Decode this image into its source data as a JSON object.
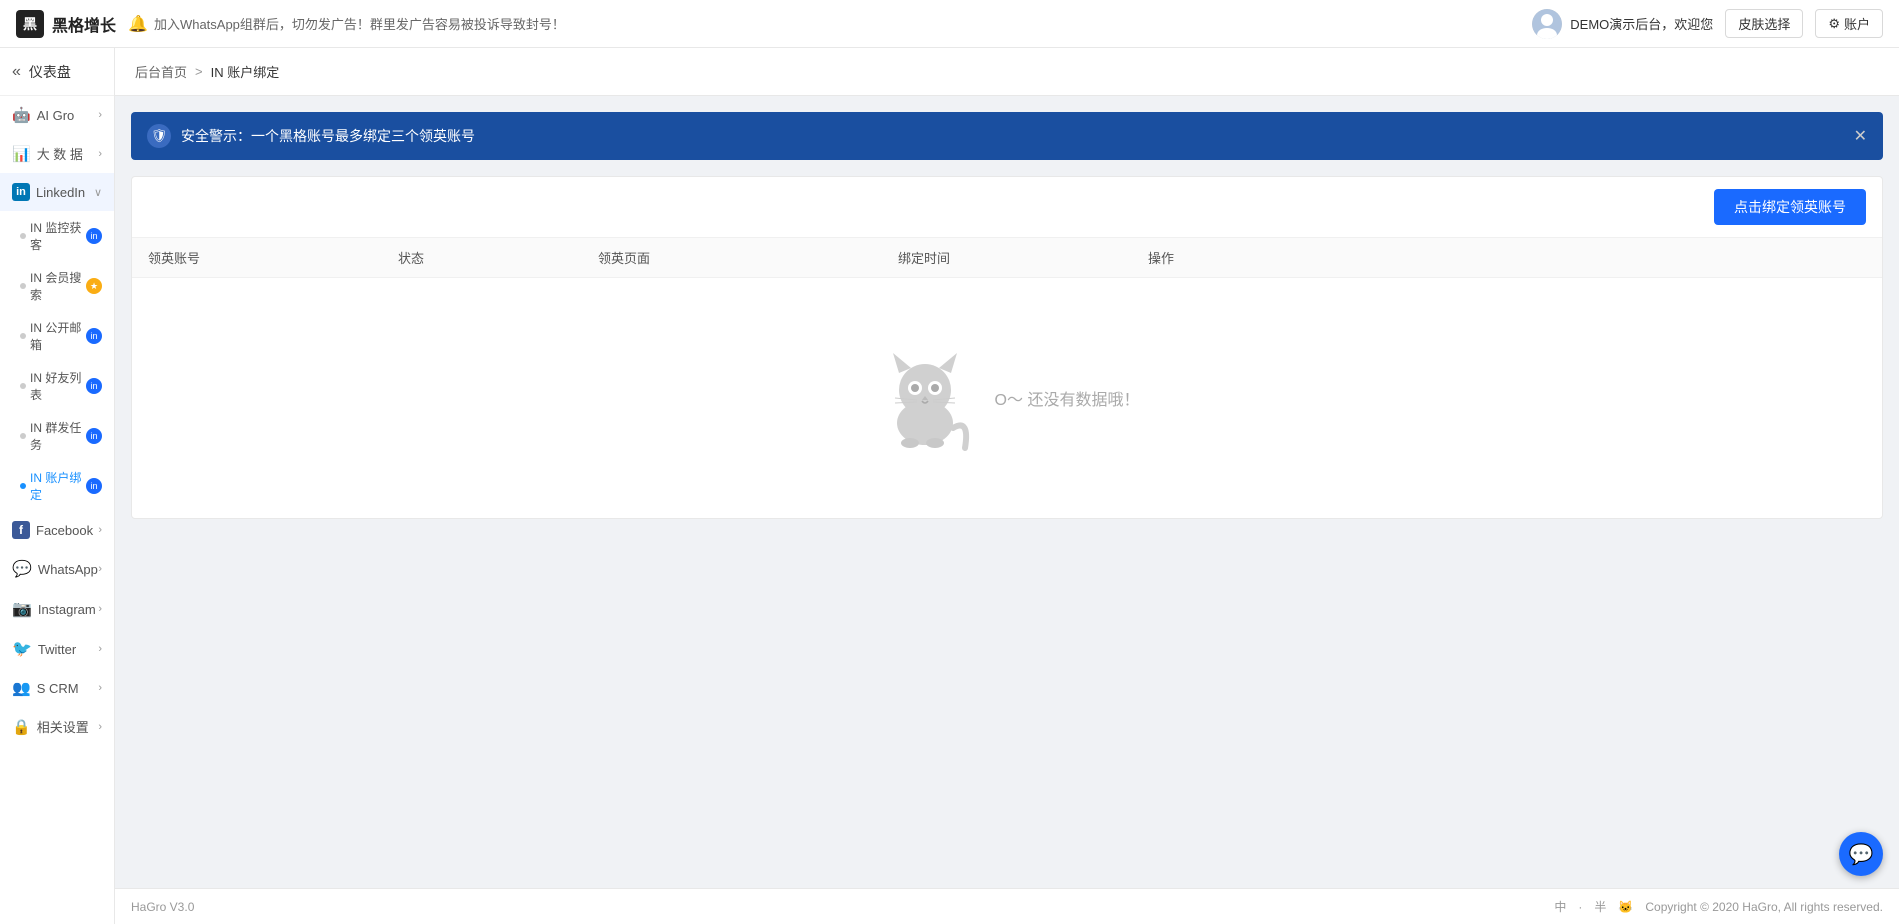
{
  "header": {
    "logo_text": "黑格增长",
    "notice_text": "加入WhatsApp组群后，切勿发广告！群里发广告容易被投诉导致封号！",
    "user_text": "DEMO演示后台，欢迎您",
    "btn_skin": "皮肤选择",
    "btn_account": "账户",
    "account_icon": "⚙"
  },
  "sidebar": {
    "dashboard_label": "仪表盘",
    "items": [
      {
        "id": "ai-gro",
        "label": "AI Gro",
        "icon": "🤖",
        "has_arrow": true
      },
      {
        "id": "big-data",
        "label": "大 数 据",
        "icon": "📊",
        "has_arrow": true
      },
      {
        "id": "linkedin",
        "label": "LinkedIn",
        "icon": "in",
        "has_arrow": true
      },
      {
        "id": "facebook",
        "label": "Facebook",
        "icon": "f",
        "has_arrow": true
      },
      {
        "id": "whatsapp",
        "label": "WhatsApp",
        "icon": "w",
        "has_arrow": true
      },
      {
        "id": "instagram",
        "label": "Instagram",
        "icon": "ig",
        "has_arrow": true
      },
      {
        "id": "twitter",
        "label": "Twitter",
        "icon": "t",
        "has_arrow": true
      },
      {
        "id": "scrm",
        "label": "S CRM",
        "icon": "👥",
        "has_arrow": true
      },
      {
        "id": "settings",
        "label": "相关设置",
        "icon": "🔒",
        "has_arrow": true
      }
    ],
    "linkedin_sub": [
      {
        "id": "in-monitor",
        "label": "IN 监控获客",
        "badge_color": "blue",
        "active": false
      },
      {
        "id": "in-member",
        "label": "IN 会员搜索",
        "badge_color": "yellow",
        "active": false
      },
      {
        "id": "in-email",
        "label": "IN 公开邮箱",
        "badge_color": "blue",
        "active": false
      },
      {
        "id": "in-friends",
        "label": "IN 好友列表",
        "badge_color": "blue",
        "active": false
      },
      {
        "id": "in-group-task",
        "label": "IN 群发任务",
        "badge_color": "blue",
        "active": false
      },
      {
        "id": "in-account",
        "label": "IN 账户绑定",
        "badge_color": "blue",
        "active": true
      }
    ]
  },
  "breadcrumb": {
    "home": "后台首页",
    "separator": ">",
    "current": "IN 账户绑定"
  },
  "alert": {
    "text": "安全警示：一个黑格账号最多绑定三个领英账号"
  },
  "table": {
    "bind_btn": "点击绑定领英账号",
    "columns": [
      "领英账号",
      "状态",
      "领英页面",
      "绑定时间",
      "操作"
    ],
    "empty_text": "O～  还没有数据哦！"
  },
  "bottom": {
    "left_text": "HaGro V3.0",
    "right_text": "Copyright © 2020 HaGro, All rights reserved.",
    "lang_options": [
      "中",
      "·",
      "半",
      "🐱"
    ]
  }
}
